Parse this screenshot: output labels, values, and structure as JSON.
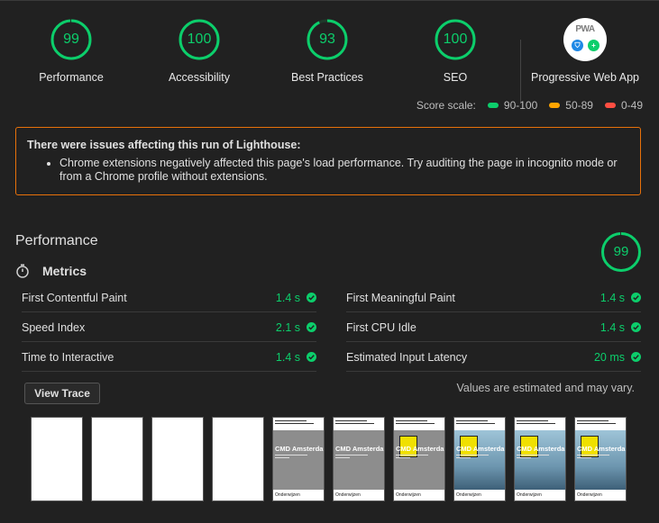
{
  "categories": [
    {
      "label": "Performance",
      "score": "99",
      "value": 99
    },
    {
      "label": "Accessibility",
      "score": "100",
      "value": 100
    },
    {
      "label": "Best Practices",
      "score": "93",
      "value": 93
    },
    {
      "label": "SEO",
      "score": "100",
      "value": 100
    }
  ],
  "pwa": {
    "label": "Progressive Web App",
    "badge_text": "PWA"
  },
  "score_scale": {
    "label": "Score scale:",
    "ranges": [
      {
        "label": "90-100",
        "color": "#0cce6b"
      },
      {
        "label": "50-89",
        "color": "#ffa400"
      },
      {
        "label": "0-49",
        "color": "#ff4e42"
      }
    ]
  },
  "warning": {
    "title": "There were issues affecting this run of Lighthouse:",
    "items": [
      "Chrome extensions negatively affected this page's load performance. Try auditing the page in incognito mode or from a Chrome profile without extensions."
    ],
    "border_color": "#e8710a"
  },
  "performance": {
    "title": "Performance",
    "score": "99",
    "value": 99,
    "metrics_title": "Metrics",
    "metrics_left": [
      {
        "name": "First Contentful Paint",
        "value": "1.4 s"
      },
      {
        "name": "Speed Index",
        "value": "2.1 s"
      },
      {
        "name": "Time to Interactive",
        "value": "1.4 s"
      }
    ],
    "metrics_right": [
      {
        "name": "First Meaningful Paint",
        "value": "1.4 s"
      },
      {
        "name": "First CPU Idle",
        "value": "1.4 s"
      },
      {
        "name": "Estimated Input Latency",
        "value": "20 ms"
      }
    ],
    "view_trace": "View Trace",
    "estimate_note": "Values are estimated and may vary."
  },
  "filmstrip": [
    {
      "state": "blank"
    },
    {
      "state": "blank"
    },
    {
      "state": "blank"
    },
    {
      "state": "blank"
    },
    {
      "state": "gray",
      "caption": "CMD Amsterdam",
      "footer": "Onderwijzen"
    },
    {
      "state": "gray",
      "caption": "CMD Amsterdam",
      "footer": "Onderwijzen"
    },
    {
      "state": "gray-yellow",
      "caption": "CMD Amsterdam",
      "footer": "Onderwijzen"
    },
    {
      "state": "photo",
      "caption": "CMD Amsterdam",
      "footer": "Onderwijzen"
    },
    {
      "state": "photo",
      "caption": "CMD Amsterdam",
      "footer": "Onderwijzen"
    },
    {
      "state": "photo",
      "caption": "CMD Amsterdam",
      "footer": "Onderwijzen"
    }
  ],
  "colors": {
    "pass": "#0cce6b",
    "background": "#212121"
  }
}
